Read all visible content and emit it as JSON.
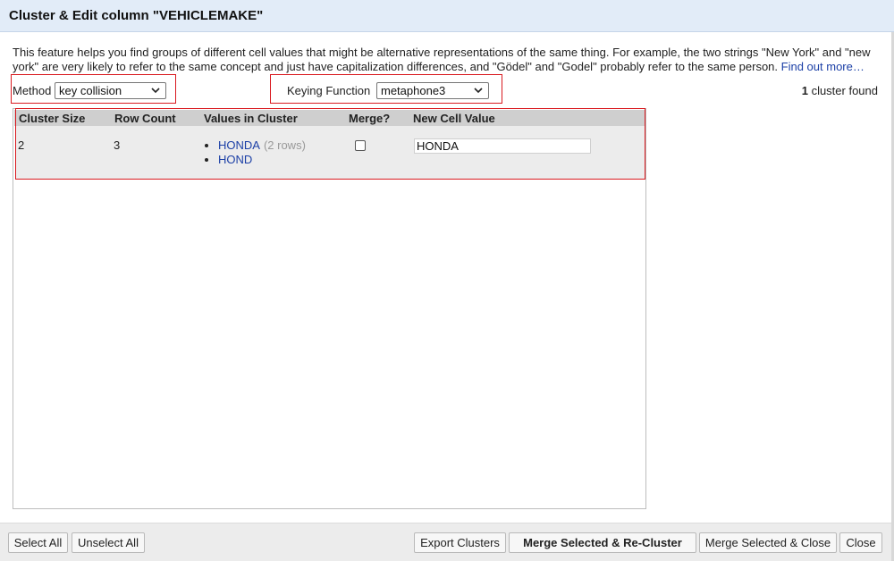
{
  "dialog": {
    "title": "Cluster & Edit column \"VEHICLEMAKE\"",
    "description": "This feature helps you find groups of different cell values that might be alternative representations of the same thing. For example, the two strings \"New York\" and \"new york\" are very likely to refer to the same concept and just have capitalization differences, and \"Gödel\" and \"Godel\" probably refer to the same person.",
    "find_out_more": "Find out more…"
  },
  "controls": {
    "method_label": "Method",
    "method_value": "key collision",
    "keying_label": "Keying Function",
    "keying_value": "metaphone3",
    "cluster_count": "1",
    "cluster_found_text": "cluster found"
  },
  "table": {
    "columns": [
      "Cluster Size",
      "Row Count",
      "Values in Cluster",
      "Merge?",
      "New Cell Value"
    ],
    "rows": [
      {
        "cluster_size": "2",
        "row_count": "3",
        "values": [
          {
            "value": "HONDA",
            "note": "(2 rows)"
          },
          {
            "value": "HOND",
            "note": ""
          }
        ],
        "merge": false,
        "new_value": "HONDA"
      }
    ]
  },
  "footer": {
    "select_all": "Select All",
    "unselect_all": "Unselect All",
    "export_clusters": "Export Clusters",
    "merge_recluster": "Merge Selected & Re-Cluster",
    "merge_close": "Merge Selected & Close",
    "close": "Close"
  },
  "colors": {
    "header_bg": "#e2ecf8",
    "highlight_border": "#d9191f",
    "link": "#1b3fa6"
  },
  "icons": [
    "chevron-down-icon"
  ]
}
